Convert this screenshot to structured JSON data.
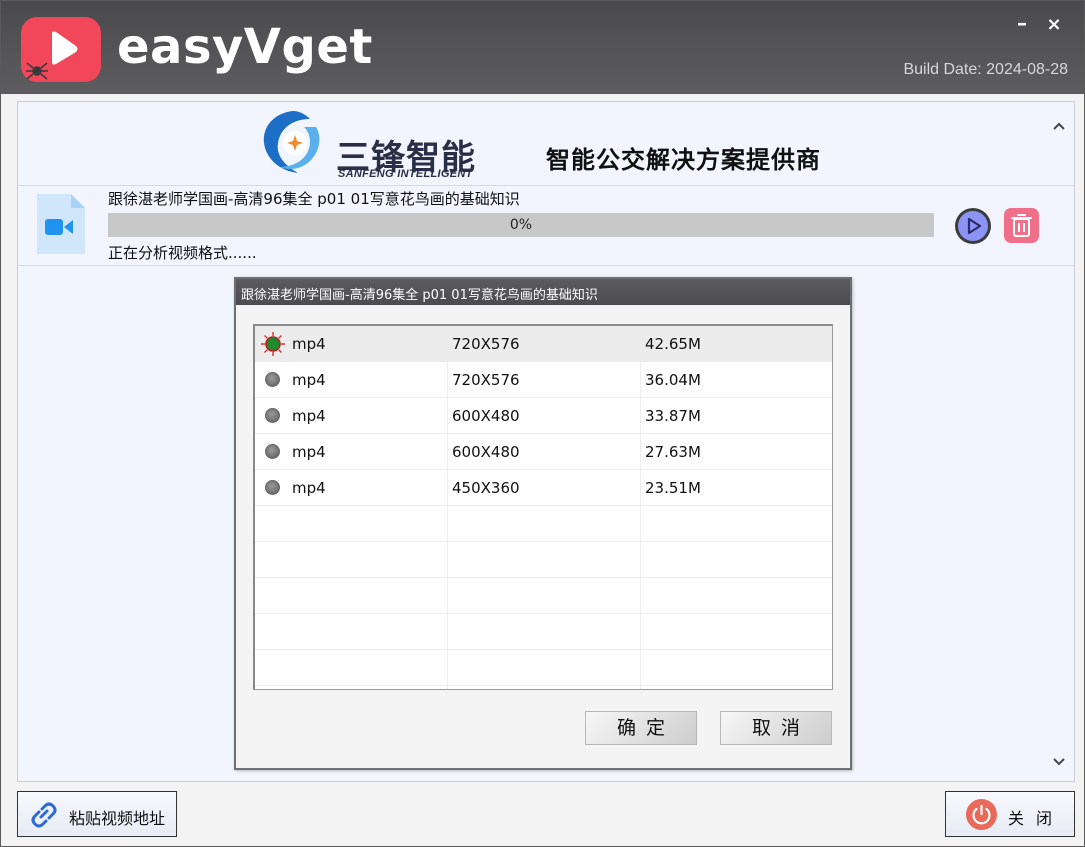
{
  "window": {
    "app_title": "easyVget",
    "build_date": "Build Date: 2024-08-28",
    "minimize_label": "–",
    "close_label": "×"
  },
  "banner": {
    "brand_cn": "三锋智能",
    "brand_en": "SANFENG INTELLIGENT",
    "slogan": "智能公交解决方案提供商"
  },
  "task": {
    "title": "跟徐湛老师学国画-高清96集全 p01 01写意花鸟画的基础知识",
    "progress": 0,
    "progress_text": "0%",
    "status": "正在分析视频格式......"
  },
  "dialog": {
    "title": "跟徐湛老师学国画-高清96集全 p01 01写意花鸟画的基础知识",
    "selected_index": 0,
    "formats": [
      {
        "format": "mp4",
        "resolution": "720X576",
        "size": "42.65M"
      },
      {
        "format": "mp4",
        "resolution": "720X576",
        "size": "36.04M"
      },
      {
        "format": "mp4",
        "resolution": "600X480",
        "size": "33.87M"
      },
      {
        "format": "mp4",
        "resolution": "600X480",
        "size": "27.63M"
      },
      {
        "format": "mp4",
        "resolution": "450X360",
        "size": "23.51M"
      }
    ],
    "ok_label": "确定",
    "cancel_label": "取消"
  },
  "footer": {
    "paste_label": "粘贴视频地址",
    "close_label": "关闭"
  },
  "colors": {
    "titlebar": "#4f4f52",
    "app_logo": "#f2475b",
    "content_bg": "#f2f5fd",
    "progress_track": "#c8c8c8",
    "play_button": "#7b7ff0",
    "delete_button": "#f0708a",
    "close_power": "#e86a5a",
    "link_icon": "#2e6ad6"
  },
  "icons": {
    "app_logo": "play-icon",
    "file": "video-file-icon",
    "play": "play-circle-icon",
    "delete": "trash-icon",
    "paste": "link-icon",
    "close": "power-icon",
    "scroll_up": "chevron-up-icon",
    "scroll_down": "chevron-down-icon"
  }
}
